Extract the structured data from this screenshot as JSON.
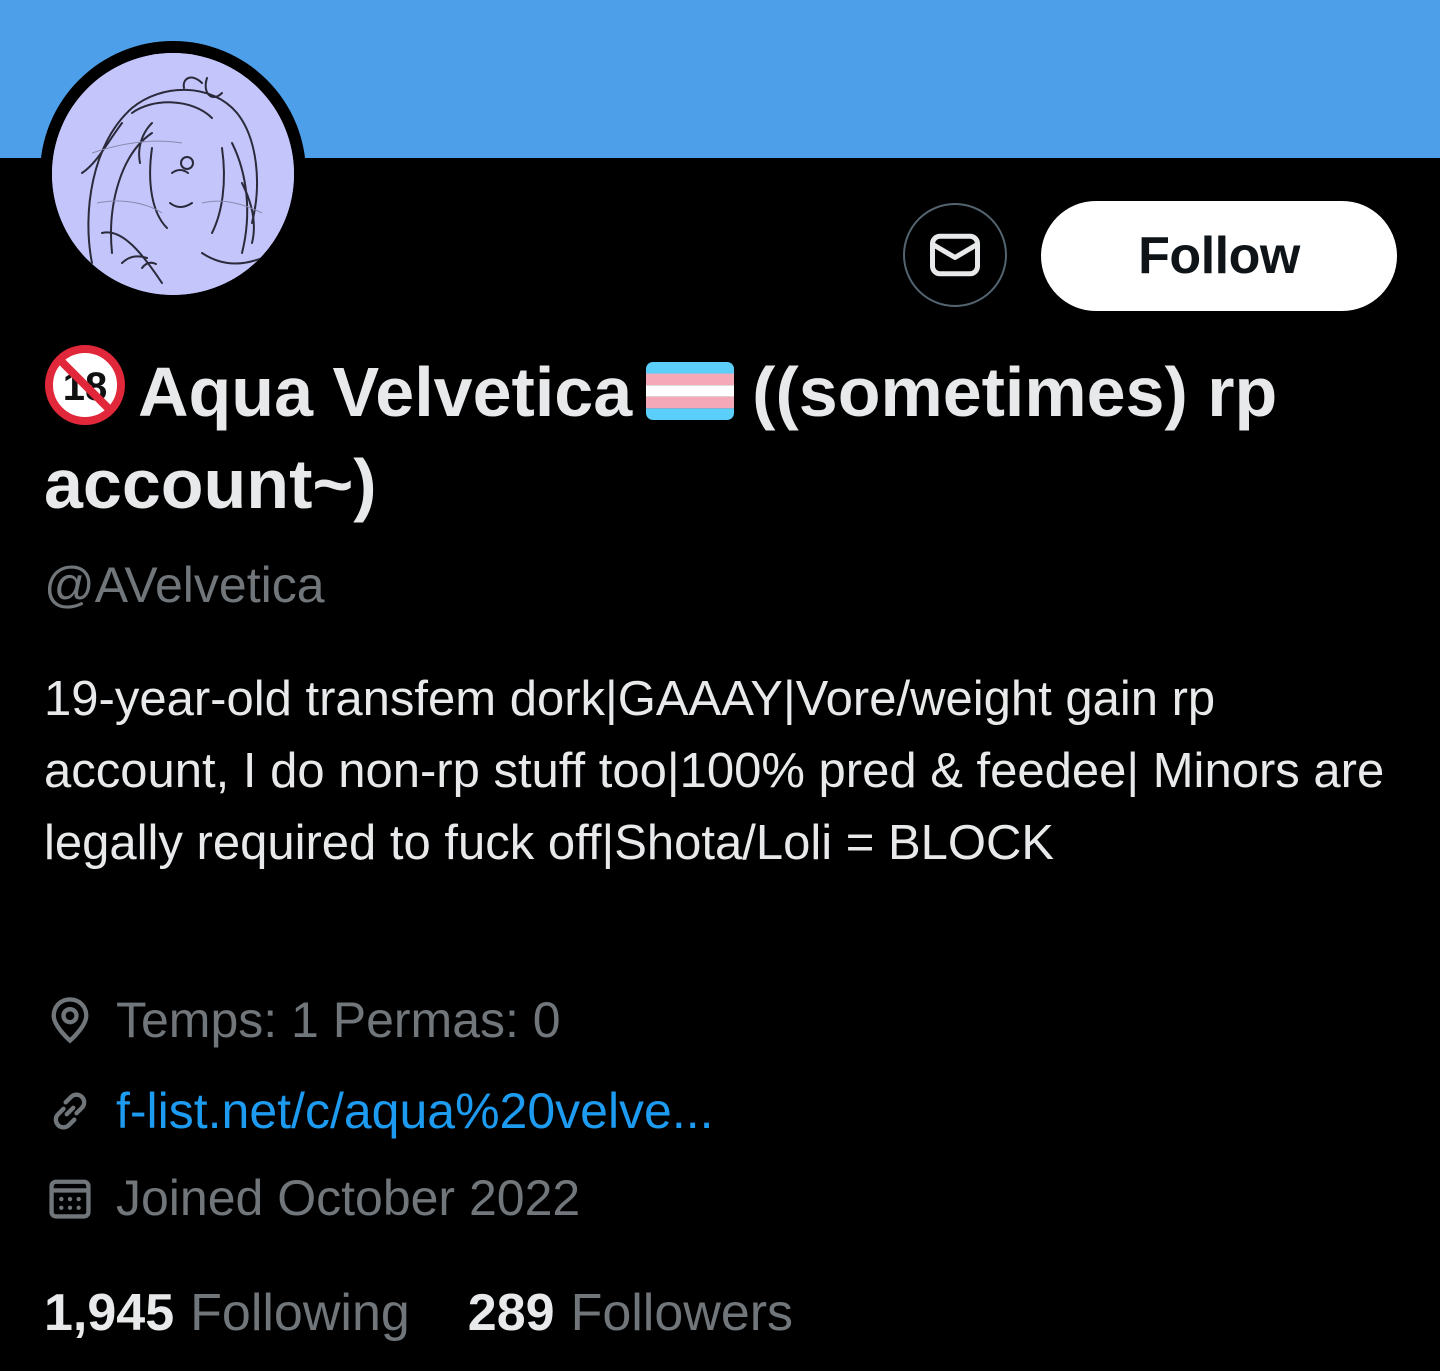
{
  "colors": {
    "banner": "#4d9fea",
    "avatar_bg": "#c4c6fb",
    "link": "#1d9bf0",
    "secondary_text": "#71767b",
    "primary_text": "#e7e9ea"
  },
  "profile": {
    "name_badge_icon": "no-under-18-icon",
    "name_part1": "Aqua Velvetica",
    "flag_icon": "transgender-flag-icon",
    "name_part2": "((sometimes) rp account~)",
    "handle": "@AVelvetica",
    "bio": "19-year-old transfem dork|GAAAY|Vore/weight gain rp account, I do non-rp stuff too|100% pred & feedee| Minors are legally required to fuck off|Shota/Loli = BLOCK",
    "location": "Temps: 1 Permas: 0",
    "location_icon": "location-pin-icon",
    "url": "f-list.net/c/aqua%20velve...",
    "url_icon": "link-icon",
    "joined": "Joined October 2022",
    "joined_icon": "calendar-icon"
  },
  "actions": {
    "message_icon": "envelope-icon",
    "follow_label": "Follow"
  },
  "stats": {
    "following_count": "1,945",
    "following_label": "Following",
    "followers_count": "289",
    "followers_label": "Followers"
  }
}
